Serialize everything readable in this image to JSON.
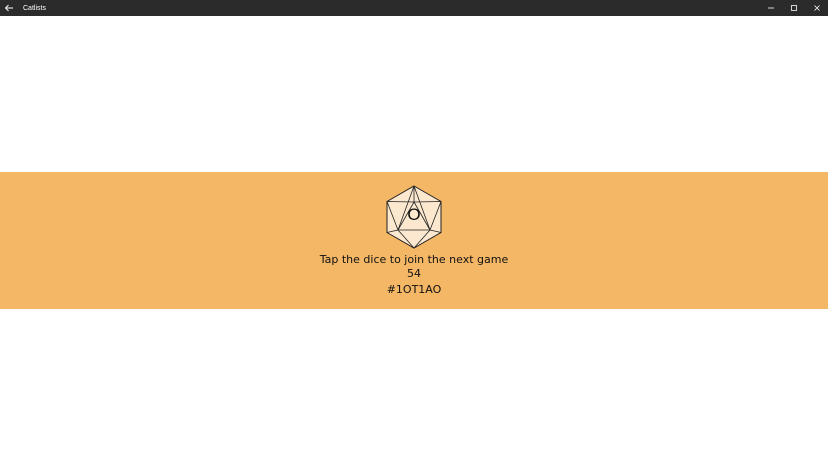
{
  "window": {
    "title": "Catlists",
    "colors": {
      "titlebar": "#2b2b2b",
      "band": "#f4b766",
      "dice_fill": "#fbe8cf"
    },
    "icons": {
      "back": "back-arrow-icon",
      "minimize": "minimize-icon",
      "maximize": "maximize-icon",
      "close": "close-icon"
    }
  },
  "main": {
    "dice_letter": "O",
    "prompt": "Tap the dice to join the next game",
    "count": "54",
    "code": "#1OT1AO"
  }
}
